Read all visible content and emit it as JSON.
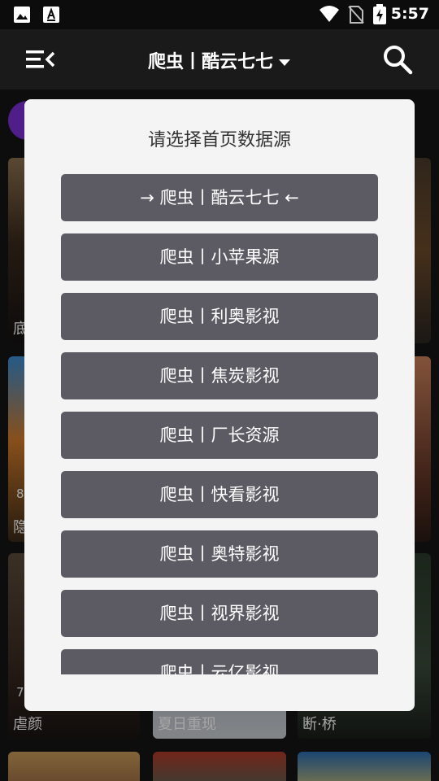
{
  "status": {
    "time": "5:57"
  },
  "header": {
    "title": "爬虫丨酷云七七",
    "icons": [
      "menu-collapse-icon",
      "chevron-down-icon",
      "search-icon"
    ]
  },
  "background": {
    "posters": [
      {
        "title": "底",
        "rating": ""
      },
      {
        "title": "隐",
        "rating": "8"
      },
      {
        "title": "虐颜",
        "rating": "7"
      },
      {
        "title": "夏日重现",
        "rating": ""
      },
      {
        "title": "断·桥",
        "rating": ""
      }
    ]
  },
  "dialog": {
    "title": "请选择首页数据源",
    "options": [
      "→ 爬虫丨酷云七七 ←",
      "爬虫丨小苹果源",
      "爬虫丨利奥影视",
      "爬虫丨焦炭影视",
      "爬虫丨厂长资源",
      "爬虫丨快看影视",
      "爬虫丨奥特影视",
      "爬虫丨视界影视",
      "爬虫丨云亿影视"
    ]
  },
  "colors": {
    "dialog_bg": "#f4f4f4",
    "option_bg": "#5c5b63",
    "accent_purple": "#7a2fd1"
  }
}
